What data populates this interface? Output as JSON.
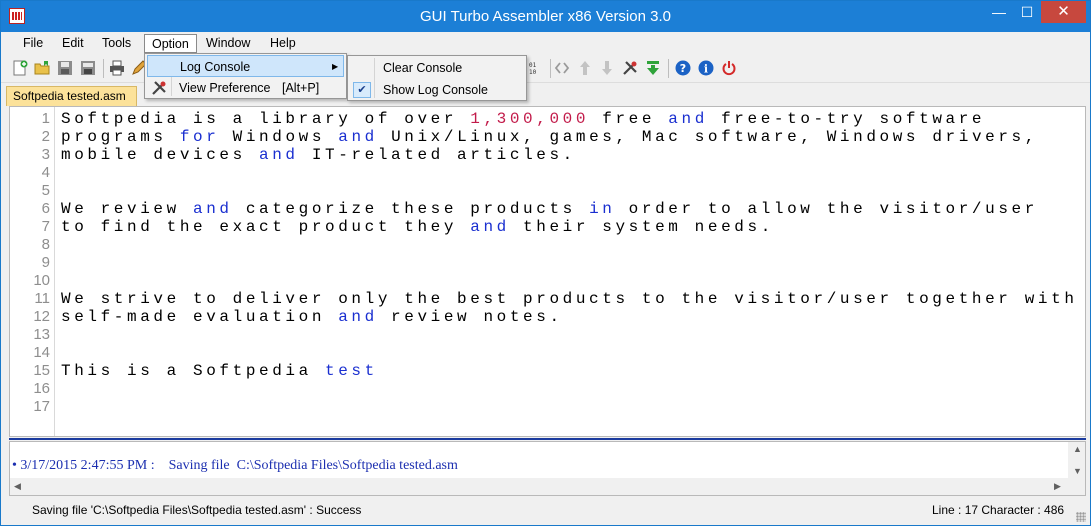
{
  "window": {
    "title": "GUI Turbo Assembler x86 Version 3.0",
    "controls": {
      "minimize": "—",
      "maximize": "☐",
      "close": "✕"
    }
  },
  "menu": {
    "file": "File",
    "edit": "Edit",
    "tools": "Tools",
    "option": "Option",
    "window": "Window",
    "help": "Help"
  },
  "option_menu": {
    "log_console": "Log Console",
    "view_preference": "View Preference",
    "view_preference_shortcut": "[Alt+P]"
  },
  "log_console_submenu": {
    "clear_console": "Clear Console",
    "show_log_console": "Show Log Console",
    "show_log_console_checked": true
  },
  "tab": {
    "label": "Softpedia tested.asm"
  },
  "editor": {
    "line_numbers": [
      "1",
      "2",
      "3",
      "4",
      "5",
      "6",
      "7",
      "8",
      "9",
      "10",
      "11",
      "12",
      "13",
      "14",
      "15",
      "16",
      "17"
    ]
  },
  "log": {
    "entry": "• 3/17/2015 2:47:55 PM :    Saving file  C:\\Softpedia Files\\Softpedia tested.asm"
  },
  "status": {
    "message": "Saving file 'C:\\Softpedia Files\\Softpedia tested.asm' : Success",
    "position": "Line : 17 Character : 486"
  },
  "colors": {
    "titlebar": "#1c7fd6",
    "keyword": "#1a2fd0",
    "number": "#c21b4a",
    "tab": "#fce29a",
    "log_text": "#1c2fb0"
  },
  "icons": [
    "new-file-icon",
    "open-folder-icon",
    "save-icon",
    "save-all-icon",
    "print-icon",
    "edit-icon",
    "binary-icon",
    "code-brackets-icon",
    "arrow-up-icon",
    "arrow-down-icon",
    "build-tools-icon",
    "download-run-icon",
    "help-icon",
    "info-icon",
    "power-icon"
  ]
}
